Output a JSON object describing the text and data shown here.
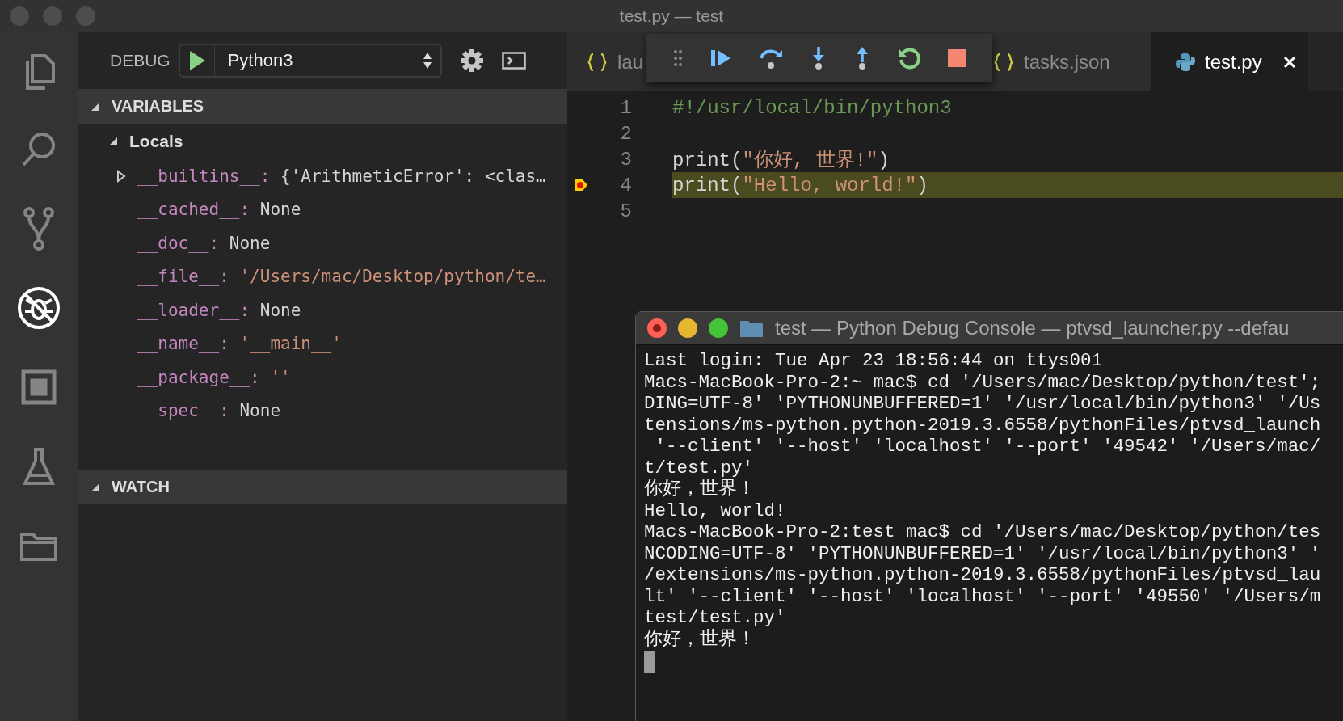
{
  "window": {
    "title": "test.py — test"
  },
  "activity_bar": [
    {
      "kind": "files",
      "selected": false
    },
    {
      "kind": "search",
      "selected": false
    },
    {
      "kind": "scm",
      "selected": false
    },
    {
      "kind": "debug",
      "selected": true
    },
    {
      "kind": "extensions",
      "selected": false
    },
    {
      "kind": "flask",
      "selected": false
    },
    {
      "kind": "folder",
      "selected": false
    }
  ],
  "debug_header": {
    "label": "DEBUG",
    "configuration": "Python3"
  },
  "variables": {
    "title": "VARIABLES",
    "expanded": true,
    "scopes": [
      {
        "name": "Locals",
        "expanded": true,
        "children": [
          {
            "name": "__builtins__:",
            "value": "{'ArithmeticError': <clas…",
            "kind": "plain",
            "expanded": false
          },
          {
            "name": "__cached__:",
            "value": "None",
            "kind": "plain"
          },
          {
            "name": "__doc__:",
            "value": "None",
            "kind": "plain"
          },
          {
            "name": "__file__:",
            "value": "'/Users/mac/Desktop/python/te…",
            "kind": "string"
          },
          {
            "name": "__loader__:",
            "value": "None",
            "kind": "plain"
          },
          {
            "name": "__name__:",
            "value": "'__main__'",
            "kind": "string"
          },
          {
            "name": "__package__:",
            "value": "''",
            "kind": "string"
          },
          {
            "name": "__spec__:",
            "value": "None",
            "kind": "plain"
          }
        ]
      }
    ]
  },
  "watch": {
    "title": "WATCH",
    "expanded": true
  },
  "tabs": [
    {
      "label": "lau",
      "kind": "json",
      "selected": false
    },
    {
      "label": "tasks.json",
      "kind": "json",
      "selected": false
    },
    {
      "label": "test.py",
      "kind": "python",
      "selected": true
    }
  ],
  "code": [
    {
      "number": "1",
      "kind": "comment",
      "text": "#!/usr/local/bin/python3",
      "current": false
    },
    {
      "number": "2",
      "kind": "blank",
      "current": false
    },
    {
      "number": "3",
      "kind": "print",
      "call": "print(",
      "arg": "\"你好, 世界!\"",
      "close": ")",
      "current": false
    },
    {
      "number": "4",
      "kind": "print",
      "call": "print(",
      "arg": "\"Hello, world!\"",
      "close": ")",
      "current": true
    },
    {
      "number": "5",
      "kind": "blank",
      "current": false
    }
  ],
  "terminal": {
    "title": "test — Python Debug Console — ptvsd_launcher.py --defau",
    "lines": [
      "Last login: Tue Apr 23 18:56:44 on ttys001",
      "Macs-MacBook-Pro-2:~ mac$ cd '/Users/mac/Desktop/python/test';",
      "DING=UTF-8' 'PYTHONUNBUFFERED=1' '/usr/local/bin/python3' '/Us",
      "tensions/ms-python.python-2019.3.6558/pythonFiles/ptvsd_launch",
      " '--client' '--host' 'localhost' '--port' '49542' '/Users/mac/",
      "t/test.py'",
      "你好，世界！",
      "Hello, world!",
      "Macs-MacBook-Pro-2:test mac$ cd '/Users/mac/Desktop/python/tes",
      "NCODING=UTF-8' 'PYTHONUNBUFFERED=1' '/usr/local/bin/python3' '",
      "/extensions/ms-python.python-2019.3.6558/pythonFiles/ptvsd_lau",
      "lt' '--client' '--host' 'localhost' '--port' '49550' '/Users/m",
      "test/test.py'",
      "你好，世界！"
    ]
  }
}
